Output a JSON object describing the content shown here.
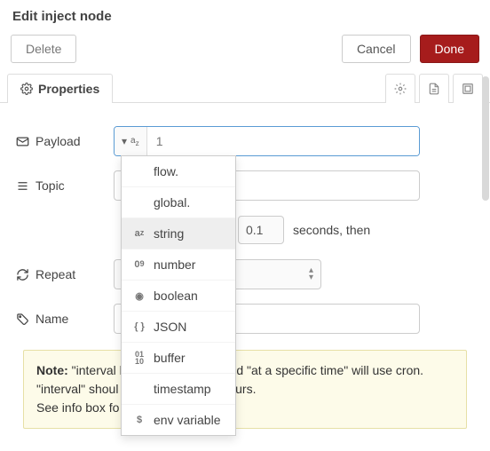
{
  "title": "Edit inject node",
  "buttons": {
    "delete": "Delete",
    "cancel": "Cancel",
    "done": "Done"
  },
  "tabs": {
    "properties": "Properties"
  },
  "labels": {
    "payload": "Payload",
    "topic": "Topic",
    "repeat": "Repeat",
    "name": "Name"
  },
  "payload": {
    "type_icon": "a_z",
    "value": "1"
  },
  "delay": {
    "value": "0.1",
    "suffix": "seconds, then"
  },
  "type_menu": {
    "items": [
      {
        "icon": "",
        "label": "flow."
      },
      {
        "icon": "",
        "label": "global."
      },
      {
        "icon": "a_z",
        "label": "string",
        "selected": true
      },
      {
        "icon": "0_9",
        "label": "number"
      },
      {
        "icon": "◉",
        "label": "boolean"
      },
      {
        "icon": "{ }",
        "label": "JSON"
      },
      {
        "icon": "01_10",
        "label": "buffer"
      },
      {
        "icon": "",
        "label": "timestamp"
      },
      {
        "icon": "$",
        "label": "env variable"
      }
    ]
  },
  "note": {
    "lead": "Note:",
    "line1a": " \"interval b",
    "line1b": "d \"at a specific time\" will use cron.",
    "line2a": "\"interval\" shoul",
    "line2b": "ours.",
    "line3": "See info box fo"
  }
}
